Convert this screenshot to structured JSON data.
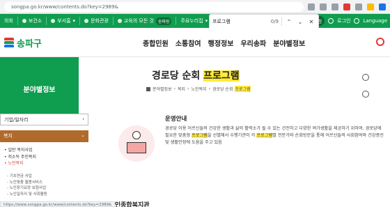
{
  "browser": {
    "url": "songpa.go.kr/www/contents.do?key=2989&",
    "status_url": "https://www.songpa.go.kr/www/contents.do?key=2989&"
  },
  "topbar": {
    "left_items": [
      "의회",
      "보건소",
      "부서홈",
      "문화관광",
      "교육의 모든 것",
      "주요누리집"
    ],
    "left_badge": "송파랑",
    "right_items": [
      "문자신청",
      "로그인",
      "Language"
    ]
  },
  "findbar": {
    "query": "프로그램",
    "count": "0/9"
  },
  "header": {
    "logo_text": "송파구",
    "nav": [
      "종합민원",
      "소통참여",
      "행정정보",
      "우리송파",
      "분야별정보"
    ]
  },
  "side": {
    "title": "분야별정보",
    "select_label": "기업/일자리",
    "category": "복지",
    "items": [
      "일반 복지사업",
      "저소득 주민복지",
      "노인복지"
    ],
    "active_item": "노인복지",
    "subitems": [
      "기초연금 사업",
      "노인맞춤 돌봄서비스",
      "노인장기요양 보험사업",
      "노인일자리 및 사회활동"
    ]
  },
  "page": {
    "title_prefix": "경로당 순회",
    "title_highlight": "프로그램",
    "breadcrumb": [
      "분야별정보",
      "복지",
      "노인복지",
      "경로당 순회",
      "프로그램"
    ]
  },
  "content": {
    "heading": "운영안내",
    "body_1": "경로당 이용 어르신들의 건강한 생활과 삶의 활력소가 될 수 있는 건전하고 다양한 여가생활을 제공하기 위하여, 경로당에 필요한 맞춤형",
    "hl_1": "프로그램",
    "body_2": "을 선별해서 수행기관이 각",
    "hl_2": "프로그램",
    "body_3": "별 전문가와 순회방문을 통해 어르신들의 사회참여와 건강증진 및 생활안정에 도움을 주고 있음",
    "next_heading": "송파노인종합복지관"
  }
}
